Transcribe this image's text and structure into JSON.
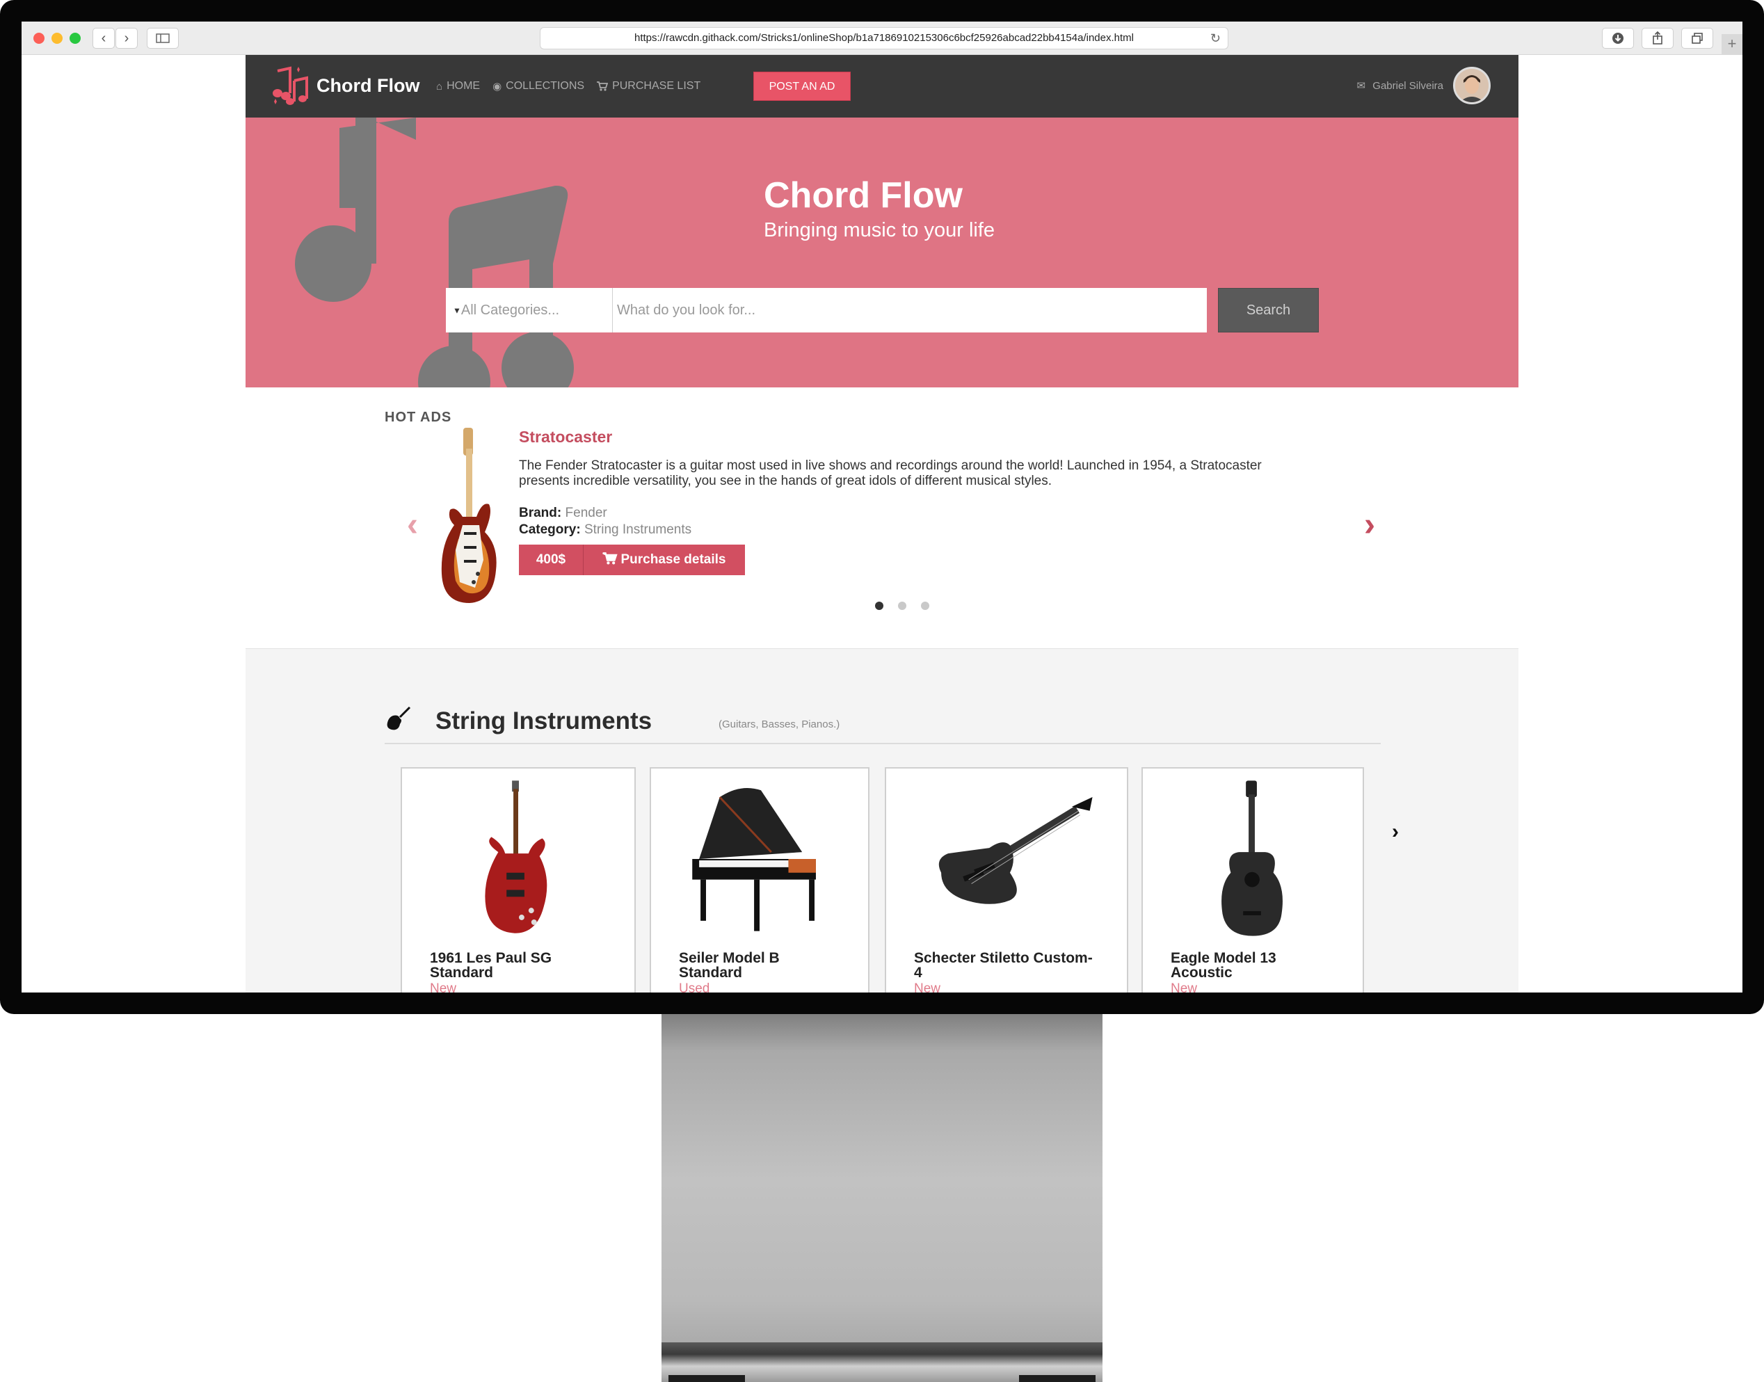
{
  "browser": {
    "url": "https://rawcdn.githack.com/Stricks1/onlineShop/b1a7186910215306c6bcf25926abcad22bb4154a/index.html",
    "back_icon": "chevron-left-icon",
    "forward_icon": "chevron-right-icon",
    "reload_icon": "reload-icon"
  },
  "nav": {
    "brand": "Chord Flow",
    "links": [
      {
        "label": "HOME",
        "icon": "home-icon"
      },
      {
        "label": "COLLECTIONS",
        "icon": "collections-icon"
      },
      {
        "label": "PURCHASE LIST",
        "icon": "cart-icon"
      }
    ],
    "post_button": "POST AN AD",
    "user_name": "Gabriel Silveira"
  },
  "hero": {
    "title": "Chord Flow",
    "subtitle": "Bringing music to your life",
    "category_placeholder": "All Categories...",
    "search_placeholder": "What do you look for...",
    "search_button": "Search"
  },
  "hot_ads": {
    "label": "HOT ADS",
    "title": "Stratocaster",
    "description": "The Fender Stratocaster is a guitar most used in live shows and recordings around the world! Launched in 1954, a Stratocaster presents incredible versatility, you see in the hands of great idols of different musical styles.",
    "brand_label": "Brand:",
    "brand": "Fender",
    "category_label": "Category:",
    "category": "String Instruments",
    "price": "400$",
    "purchase_button": "Purchase details",
    "slide_count": 3,
    "active_slide": 1
  },
  "category": {
    "title": "String Instruments",
    "subtitle": "(Guitars, Basses, Pianos.)",
    "products": [
      {
        "name_line1": "1961 Les Paul SG",
        "name_line2": "Standard",
        "condition": "New"
      },
      {
        "name_line1": "Seiler Model B",
        "name_line2": "Standard",
        "condition": "Used"
      },
      {
        "name_line1": "Schecter Stiletto Custom-",
        "name_line2": "4",
        "condition": "New"
      },
      {
        "name_line1": "Eagle Model 13",
        "name_line2": "Acoustic",
        "condition": "New"
      }
    ]
  },
  "colors": {
    "accent": "#e85467",
    "hero_bg": "#df7484",
    "navbar_bg": "#383838"
  }
}
